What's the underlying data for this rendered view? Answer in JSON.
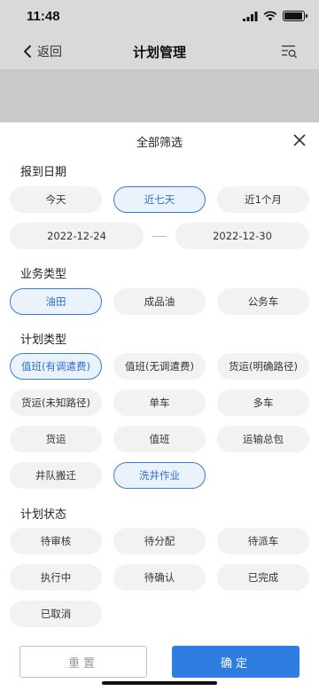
{
  "status_bar": {
    "time": "11:48"
  },
  "nav": {
    "back_label": "返回",
    "title": "计划管理"
  },
  "sheet": {
    "title": "全部筛选"
  },
  "report_date": {
    "title": "报到日期",
    "options": [
      "今天",
      "近七天",
      "近1个月"
    ],
    "selected": "近七天",
    "start_date": "2022-12-24",
    "end_date": "2022-12-30"
  },
  "business_type": {
    "title": "业务类型",
    "options": [
      "油田",
      "成品油",
      "公务车"
    ],
    "selected": "油田"
  },
  "plan_type": {
    "title": "计划类型",
    "options": [
      "值班(有调遣费)",
      "值班(无调遣费)",
      "货运(明确路径)",
      "货运(未知路径)",
      "单车",
      "多车",
      "货运",
      "值班",
      "运输总包",
      "井队搬迁",
      "洗井作业"
    ],
    "selected": [
      "值班(有调遣费)",
      "洗井作业"
    ]
  },
  "plan_status": {
    "title": "计划状态",
    "options": [
      "待审核",
      "待分配",
      "待派车",
      "执行中",
      "待确认",
      "已完成",
      "已取消"
    ]
  },
  "footer": {
    "reset_label": "重置",
    "confirm_label": "确定"
  },
  "colors": {
    "accent": "#2f7de1",
    "chip_bg": "#f2f2f2",
    "selected_bg": "#eaf2fc"
  }
}
